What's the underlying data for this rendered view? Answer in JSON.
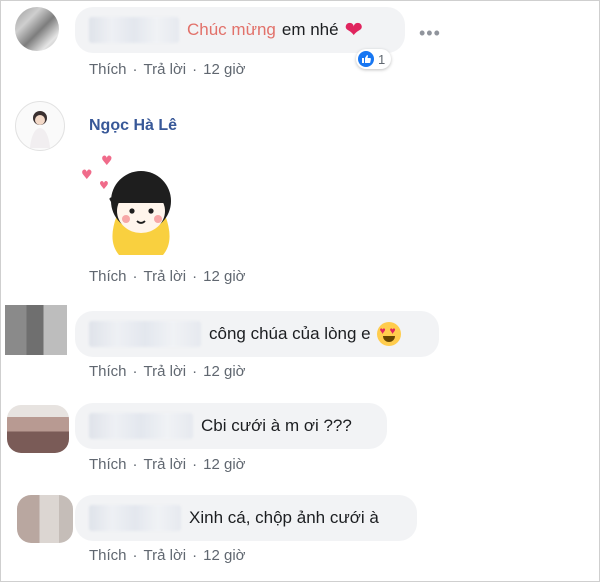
{
  "comments": [
    {
      "id": "c1",
      "text_highlight": "Chúc mừng",
      "text": "em nhé",
      "emoji": "heart",
      "reaction_count": "1",
      "actions": {
        "like": "Thích",
        "reply": "Trả lời",
        "time": "12 giờ"
      }
    },
    {
      "id": "c2",
      "author": "Ngọc Hà Lê",
      "sticker": "girl-sticker",
      "actions": {
        "like": "Thích",
        "reply": "Trả lời",
        "time": "12 giờ"
      }
    },
    {
      "id": "c3",
      "text": "công chúa của lòng e",
      "emoji": "heart-eyes",
      "actions": {
        "like": "Thích",
        "reply": "Trả lời",
        "time": "12 giờ"
      }
    },
    {
      "id": "c4",
      "text": "Cbi cưới à m ơi ???",
      "actions": {
        "like": "Thích",
        "reply": "Trả lời",
        "time": "12 giờ"
      }
    },
    {
      "id": "c5",
      "text": "Xinh cá, chộp ảnh cưới à",
      "actions": {
        "like": "Thích",
        "reply": "Trả lời",
        "time": "12 giờ"
      }
    }
  ],
  "separator": "·",
  "more_label": "•••",
  "colors": {
    "link": "#385898",
    "highlight": "#e2716a",
    "bubble": "#f2f3f5",
    "meta": "#606770",
    "like": "#1877f2"
  }
}
